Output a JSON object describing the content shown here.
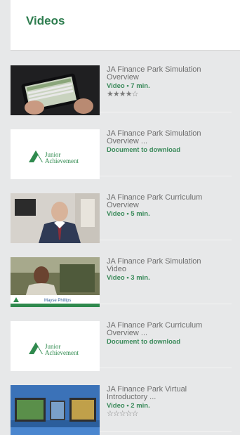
{
  "header": {
    "title": "Videos"
  },
  "items": [
    {
      "title_line1": "JA Finance Park Simulation",
      "title_line2": "Overview",
      "subtitle": "Video • 7 min.",
      "rating": 4,
      "rating_text": "★★★★☆"
    },
    {
      "title_line1": "JA Finance Park Simulation",
      "title_line2": "Overview ...",
      "subtitle": "Document to download"
    },
    {
      "title_line1": "JA Finance Park Curriculum",
      "title_line2": "Overview",
      "subtitle": "Video • 5 min."
    },
    {
      "title_line1": "JA Finance Park Simulation",
      "title_line2": "Video",
      "subtitle": "Video • 3 min."
    },
    {
      "title_line1": "JA Finance Park Curriculum",
      "title_line2": "Overview ...",
      "subtitle": "Document to download"
    },
    {
      "title_line1": "JA Finance Park Virtual",
      "title_line2": "Introductory ...",
      "subtitle": "Video • 2 min.",
      "rating": 0,
      "rating_text": "☆☆☆☆☆"
    }
  ],
  "logo": {
    "line1": "Junior",
    "line2": "Achievement"
  },
  "caption": {
    "name": "Mayse Phillips"
  },
  "colors": {
    "accent": "#2e7d4f",
    "brand_green": "#2f8a4e"
  }
}
